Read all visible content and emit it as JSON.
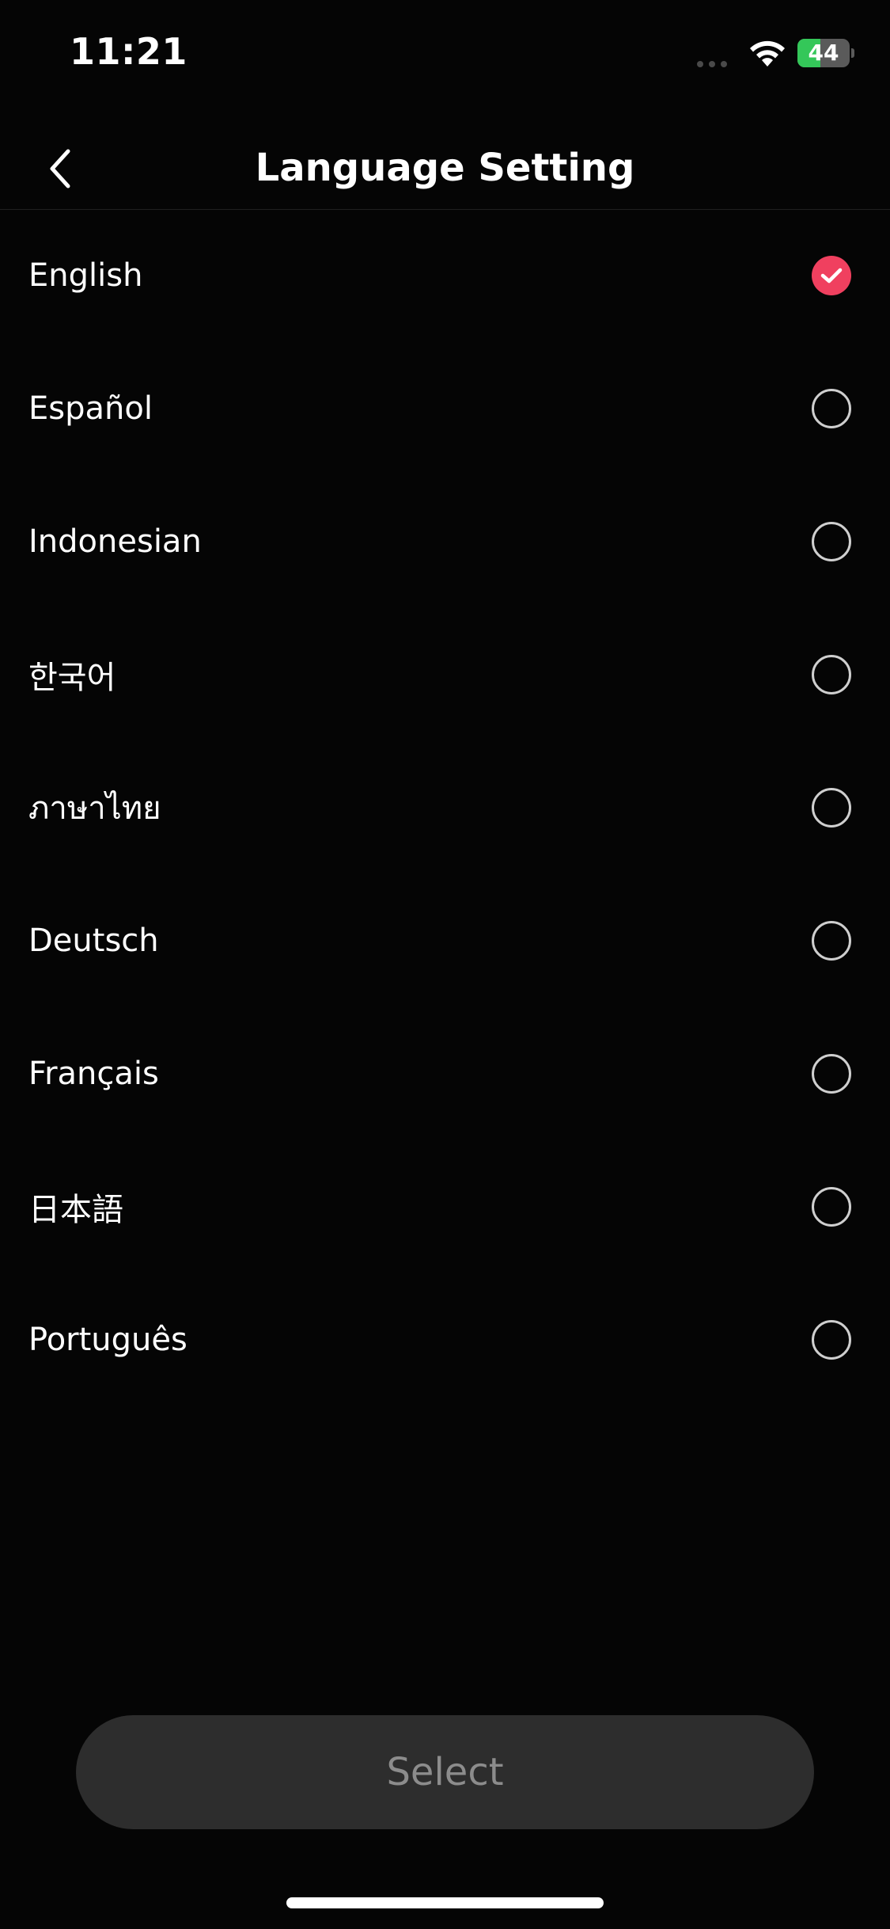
{
  "status_bar": {
    "time": "11:21",
    "battery_level": "44",
    "battery_fraction": 0.44,
    "cellular_icon": "cellular-dots-icon",
    "wifi_icon": "wifi-icon",
    "battery_icon": "battery-charging-icon"
  },
  "header": {
    "title": "Language Setting",
    "back_icon": "chevron-left-icon"
  },
  "languages": [
    {
      "label": "English",
      "selected": true
    },
    {
      "label": "Español",
      "selected": false
    },
    {
      "label": "Indonesian",
      "selected": false
    },
    {
      "label": "한국어",
      "selected": false
    },
    {
      "label": "ภาษาไทย",
      "selected": false
    },
    {
      "label": "Deutsch",
      "selected": false
    },
    {
      "label": "Français",
      "selected": false
    },
    {
      "label": "日本語",
      "selected": false
    },
    {
      "label": "Português",
      "selected": false
    }
  ],
  "footer": {
    "select_label": "Select"
  },
  "colors": {
    "background": "#050505",
    "accent": "#f0405f",
    "button_bg": "#2d2d2d",
    "button_text": "#8c8c8c",
    "battery_green": "#34c759"
  }
}
